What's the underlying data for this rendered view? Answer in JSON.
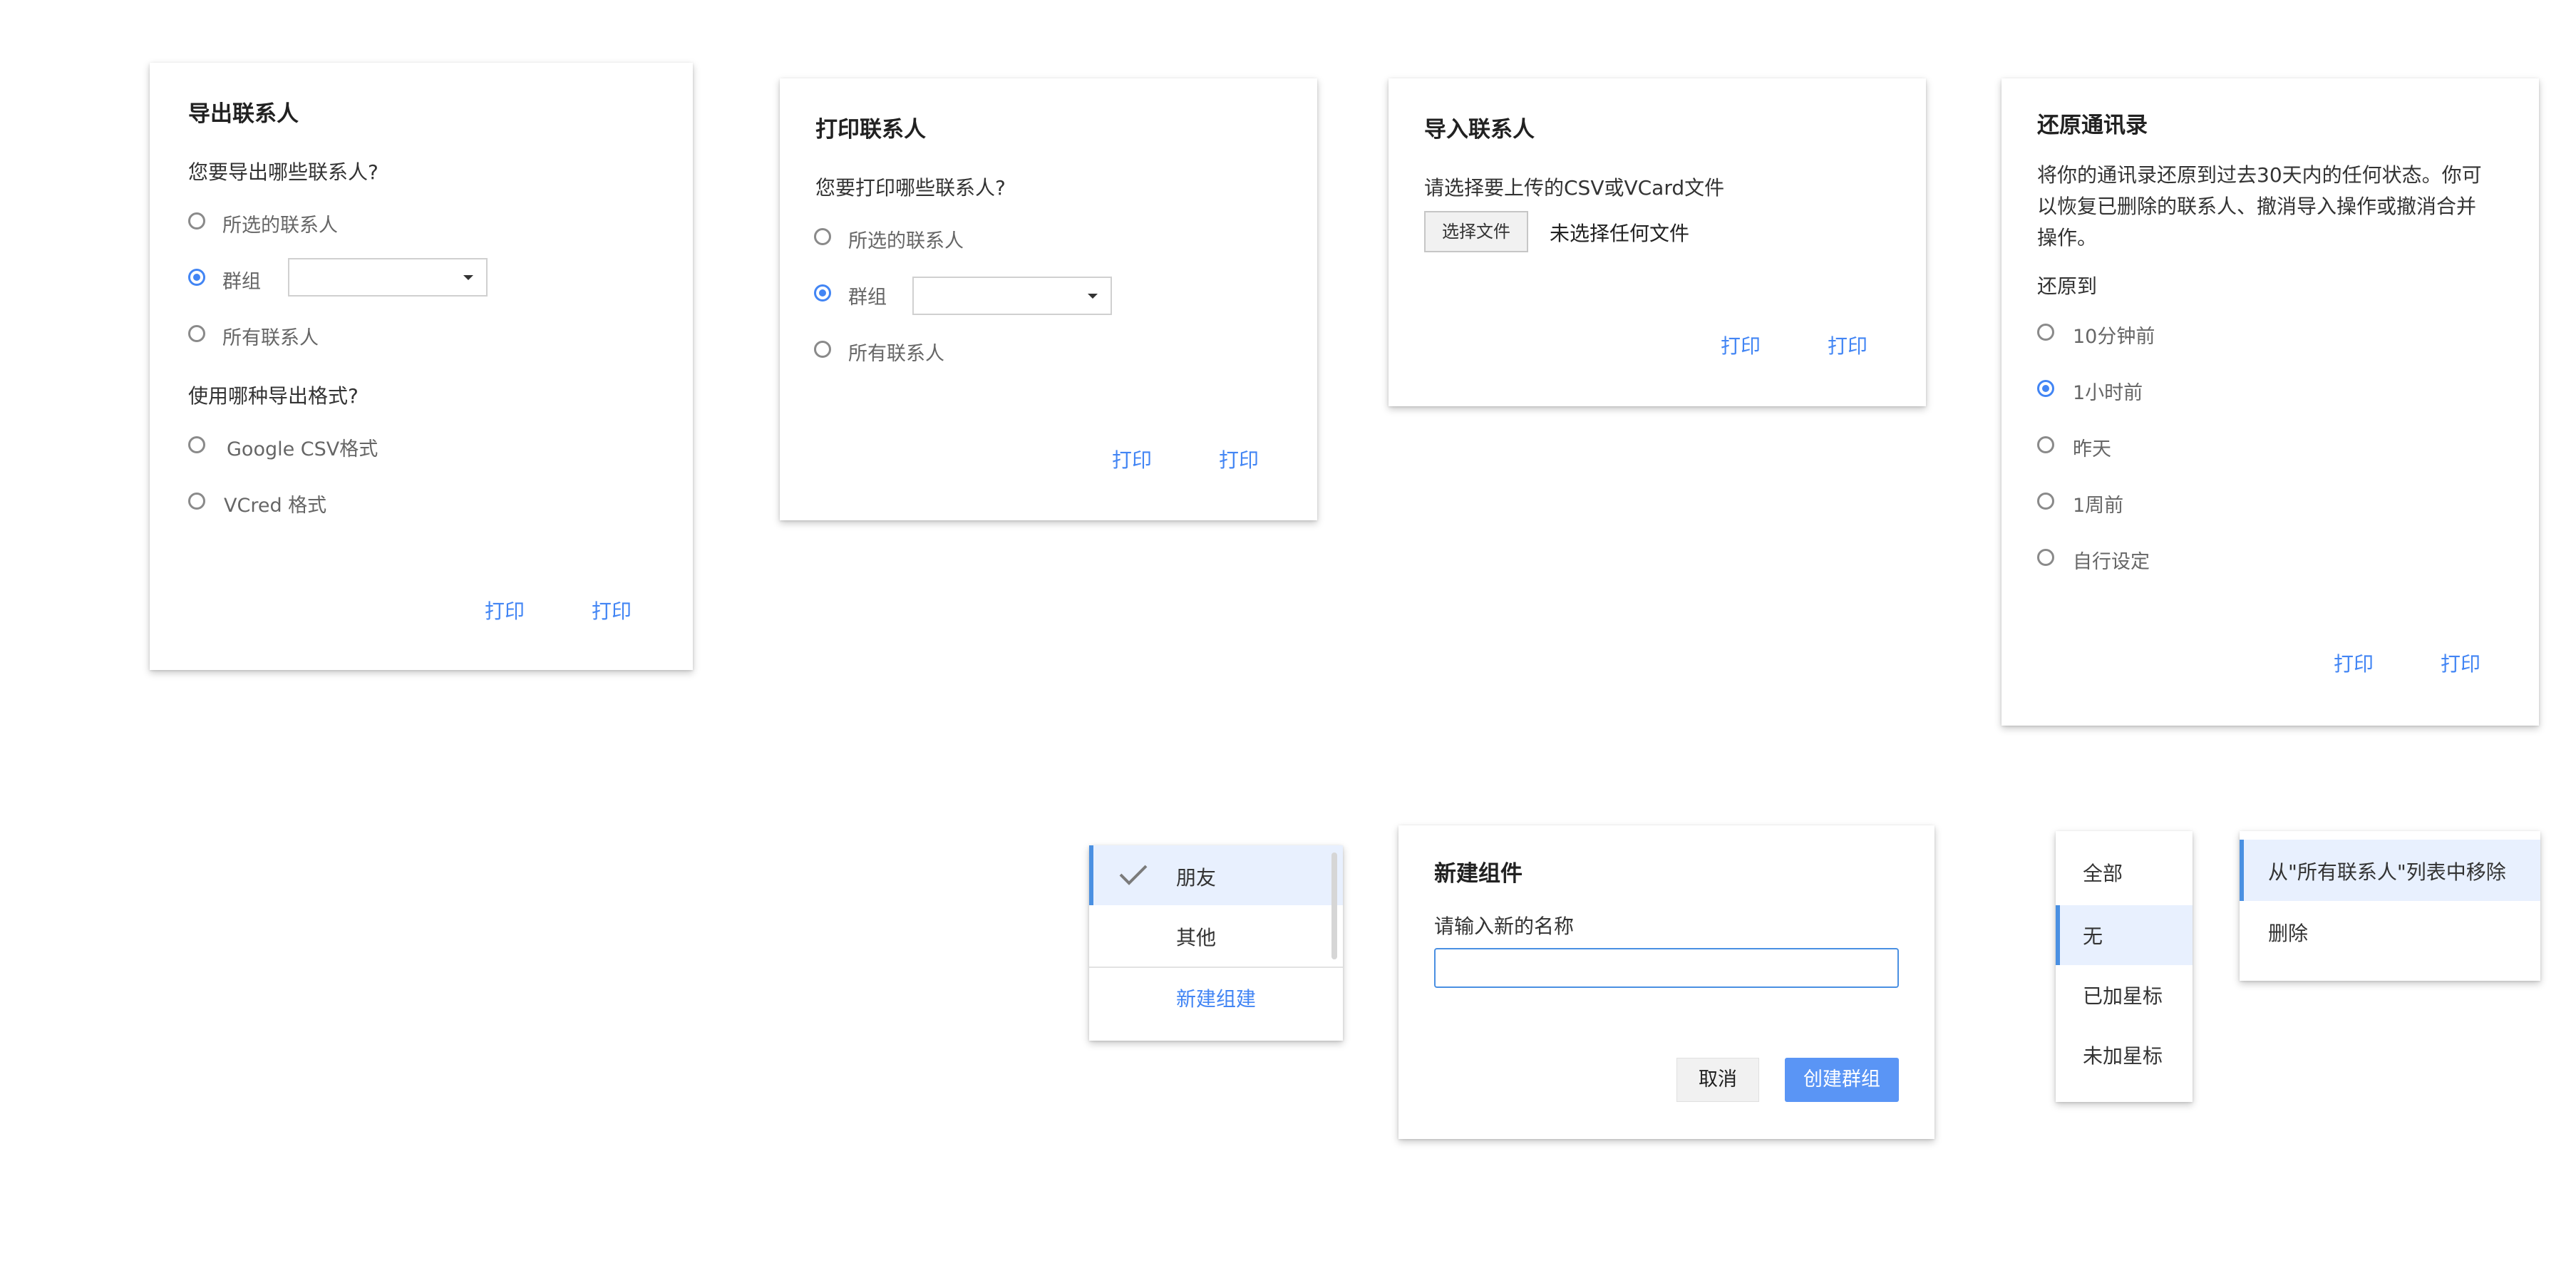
{
  "print_label": "打印",
  "export_dialog": {
    "title": "导出联系人",
    "question1": "您要导出哪些联系人?",
    "options": [
      "所选的联系人",
      "群组",
      "所有联系人"
    ],
    "question2": "使用哪种导出格式?",
    "formats": [
      "Google CSV格式",
      "VCred 格式"
    ]
  },
  "print_dialog": {
    "title": "打印联系人",
    "question": "您要打印哪些联系人?",
    "options": [
      "所选的联系人",
      "群组",
      "所有联系人"
    ]
  },
  "import_dialog": {
    "title": "导入联系人",
    "prompt": "请选择要上传的CSV或VCard文件",
    "choose_file": "选择文件",
    "no_file": "未选择任何文件"
  },
  "restore_dialog": {
    "title": "还原通讯录",
    "desc_lines": [
      "将你的通讯录还原到过去30天内的任何状态。你可",
      "以恢复已删除的联系人、撤消导入操作或撤消合并",
      "操作。"
    ],
    "restore_to": "还原到",
    "options": [
      "10分钟前",
      "1小时前",
      "昨天",
      "1周前",
      "自行设定"
    ]
  },
  "group_menu": {
    "items": [
      "朋友",
      "其他"
    ],
    "new_group": "新建组建"
  },
  "new_group_dialog": {
    "title": "新建组件",
    "label": "请输入新的名称",
    "input_value": "",
    "cancel": "取消",
    "create": "创建群组"
  },
  "filter_menu": {
    "items": [
      "全部",
      "无",
      "已加星标",
      "未加星标"
    ]
  },
  "action_menu": {
    "items": [
      "从\"所有联系人\"列表中移除",
      "删除"
    ]
  },
  "colors": {
    "accent": "#4285f4",
    "selected_bg": "#e8f0fe",
    "selected_bar": "#4a90e2",
    "primary_button": "#5a95f5"
  }
}
